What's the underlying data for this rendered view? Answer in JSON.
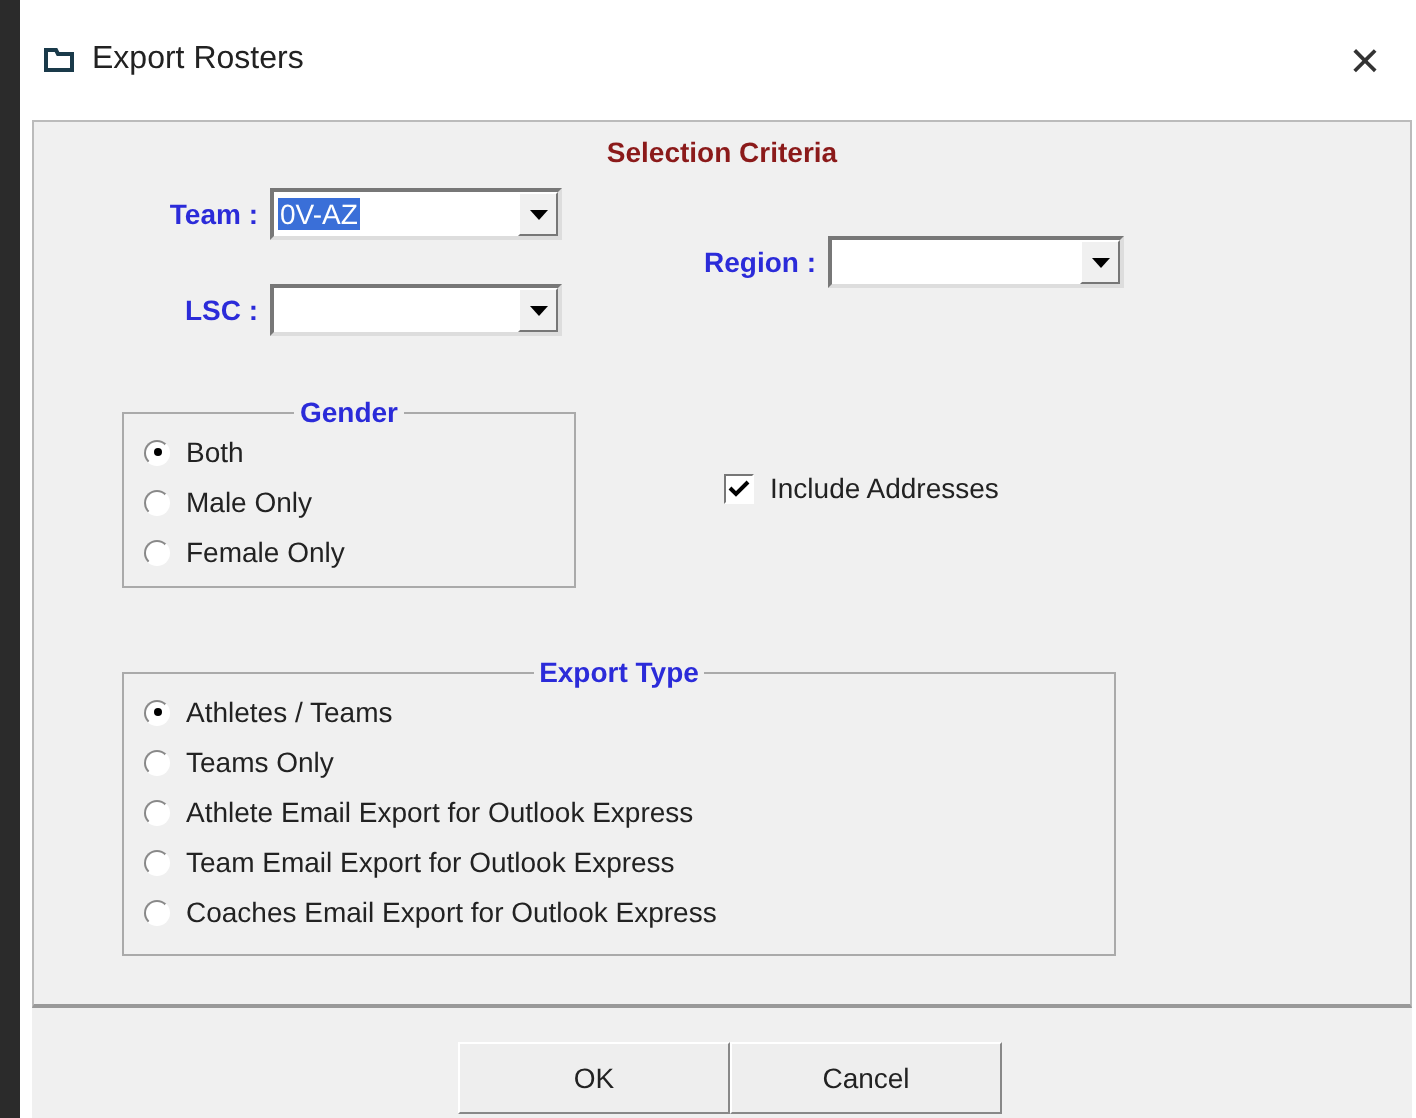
{
  "window": {
    "title": "Export Rosters",
    "close": "×"
  },
  "selection_criteria": {
    "title": "Selection Criteria",
    "team": {
      "label": "Team :",
      "value": "0V-AZ",
      "selected": true
    },
    "lsc": {
      "label": "LSC :"
    },
    "region": {
      "label": "Region :"
    }
  },
  "gender": {
    "title": "Gender",
    "options": [
      {
        "label": "Both",
        "selected": true
      },
      {
        "label": "Male Only",
        "selected": false
      },
      {
        "label": "Female Only",
        "selected": false
      }
    ]
  },
  "include_addresses": {
    "label": "Include Addresses",
    "checked": true
  },
  "export_type": {
    "title": "Export Type",
    "options": [
      {
        "label": "Athletes / Teams",
        "selected": true
      },
      {
        "label": "Teams Only",
        "selected": false
      },
      {
        "label": "Athlete Email Export for Outlook Express",
        "selected": false
      },
      {
        "label": "Team Email Export for Outlook Express",
        "selected": false
      },
      {
        "label": "Coaches Email Export for Outlook Express",
        "selected": false
      }
    ]
  },
  "buttons": [
    "OK",
    "Cancel"
  ]
}
